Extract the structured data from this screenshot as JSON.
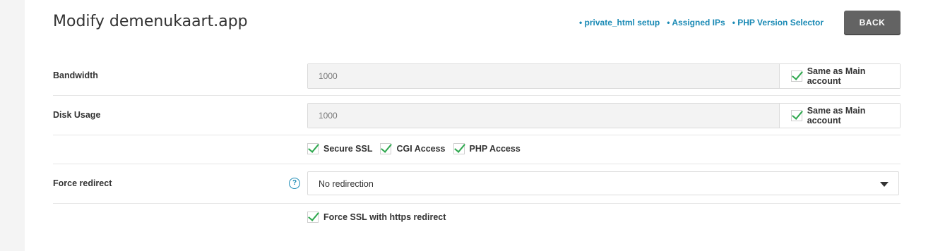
{
  "header": {
    "title": "Modify demenukaart.app",
    "links": [
      "• private_html setup",
      "• Assigned IPs",
      "• PHP Version Selector"
    ],
    "back_label": "BACK"
  },
  "form": {
    "bandwidth": {
      "label": "Bandwidth",
      "value": "1000",
      "same_label": "Same as Main account",
      "same_checked": true
    },
    "disk": {
      "label": "Disk Usage",
      "value": "1000",
      "same_label": "Same as Main account",
      "same_checked": true
    },
    "options": [
      {
        "label": "Secure SSL",
        "checked": true
      },
      {
        "label": "CGI Access",
        "checked": true
      },
      {
        "label": "PHP Access",
        "checked": true
      }
    ],
    "force_redirect": {
      "label": "Force redirect",
      "help_icon": "help-icon",
      "selected": "No redirection"
    },
    "force_ssl": {
      "label": "Force SSL with https redirect",
      "checked": true
    }
  },
  "colors": {
    "accent": "#1a8ab5",
    "check": "#2fa84f",
    "button": "#636363"
  }
}
